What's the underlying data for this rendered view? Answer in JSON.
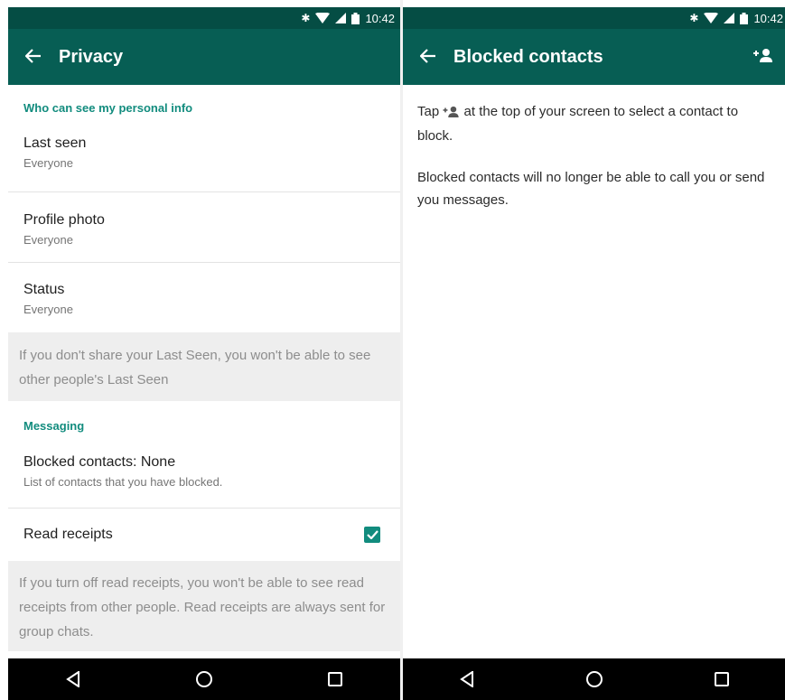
{
  "status_bar": {
    "time": "10:42"
  },
  "privacy": {
    "title": "Privacy",
    "section_personal": "Who can see my personal info",
    "items": [
      {
        "title": "Last seen",
        "value": "Everyone"
      },
      {
        "title": "Profile photo",
        "value": "Everyone"
      },
      {
        "title": "Status",
        "value": "Everyone"
      }
    ],
    "last_seen_note": "If you don't share your Last Seen, you won't be able to see other people's Last Seen",
    "section_messaging": "Messaging",
    "blocked_title": "Blocked contacts: None",
    "blocked_sub": "List of contacts that you have blocked.",
    "read_receipts_label": "Read receipts",
    "read_receipts_checked": true,
    "read_receipts_note": "If you turn off read receipts, you won't be able to see read receipts from other people. Read receipts are always sent for group chats."
  },
  "blocked": {
    "title": "Blocked contacts",
    "line1_before": "Tap",
    "line1_after": "at the top of your screen to select a contact to block.",
    "line2": "Blocked contacts will no longer be able to call you or send you messages."
  },
  "colors": {
    "status_bar": "#054d44",
    "app_bar": "#075e54",
    "accent": "#128c7e",
    "note_bg": "#eeeeee"
  },
  "icons": [
    "bluetooth-icon",
    "wifi-icon",
    "signal-icon",
    "battery-icon",
    "back-arrow-icon",
    "add-contact-icon",
    "checkbox-checked-icon",
    "nav-back-icon",
    "nav-home-icon",
    "nav-recents-icon"
  ]
}
